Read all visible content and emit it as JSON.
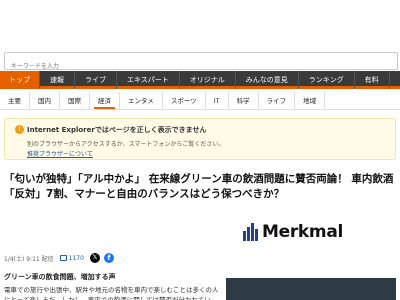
{
  "search": {
    "placeholder": "キーワードを入力"
  },
  "nav": {
    "tabs": [
      {
        "label": "トップ"
      },
      {
        "label": "速報"
      },
      {
        "label": "ライブ"
      },
      {
        "label": "エキスパート"
      },
      {
        "label": "オリジナル"
      },
      {
        "label": "みんなの意見"
      },
      {
        "label": "ランキング"
      },
      {
        "label": "有料"
      }
    ],
    "active_index": 0,
    "accent_color": "#e66000"
  },
  "subnav": {
    "items": [
      {
        "label": "主要"
      },
      {
        "label": "国内"
      },
      {
        "label": "国際"
      },
      {
        "label": "経済"
      },
      {
        "label": "エンタメ"
      },
      {
        "label": "スポーツ"
      },
      {
        "label": "IT"
      },
      {
        "label": "科学"
      },
      {
        "label": "ライフ"
      },
      {
        "label": "地域"
      }
    ],
    "active_index": 3
  },
  "ie_notice": {
    "title": "Internet Explorerではページを正しく表示できません",
    "text": "別のブラウザーからアクセスするか、スマートフォンからご覧ください。",
    "link": "推奨ブラウザーについて",
    "icon": "warning-icon"
  },
  "article": {
    "headline": "「匂いが独特」「アル中かよ」 在来線グリーン車の飲酒問題に賛否両論！ 車内飲酒「反対」7割、マナーと自由のバランスはどう保つべきか？",
    "date": "1/4(土) 9:11 配信",
    "comment_count": "1170",
    "source_brand": "Merkmal",
    "section_title": "グリーン車の飲食問題、増加する声",
    "body": "電車での旅行や出張中、駅弁や地元の名物を車内で楽しむことは多くの人にとって楽しみだ。しかし、車内での飲酒に関しては賛否が分かれている。"
  }
}
